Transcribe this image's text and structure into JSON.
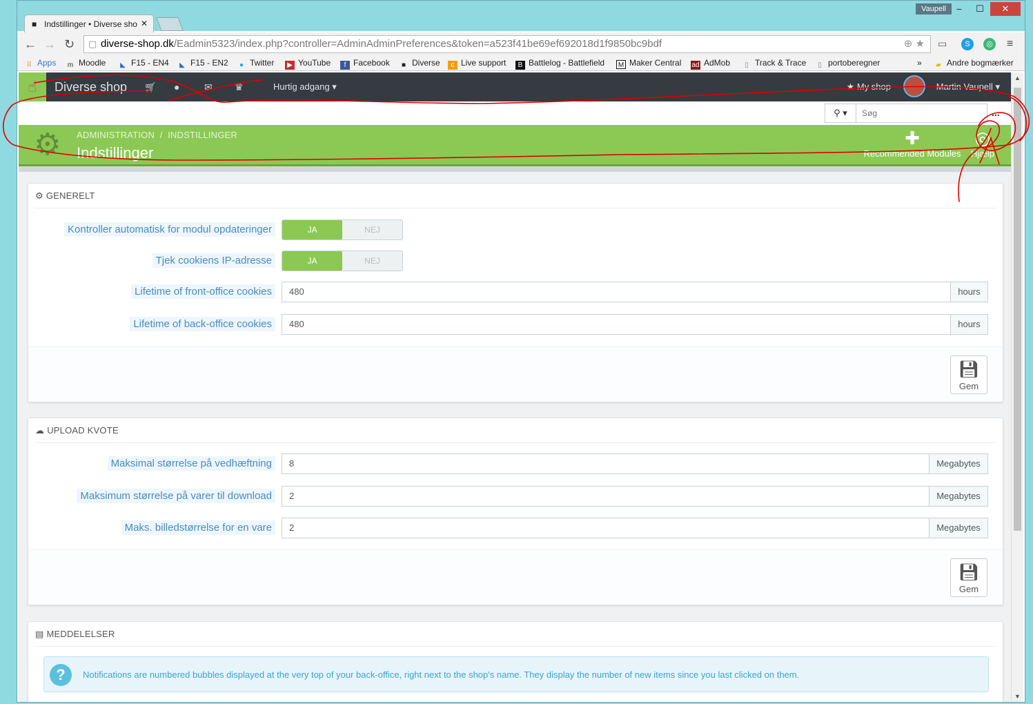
{
  "browser": {
    "profile": "Vaupell",
    "tab_title": "Indstillinger • Diverse sho",
    "url_host": "diverse-shop.dk",
    "url_path": "/Eadmin5323/index.php?controller=AdminAdminPreferences&token=a523f41be69ef692018d1f9850bc9bdf",
    "bookmarks": [
      "Apps",
      "Moodle",
      "F15 - EN4",
      "F15 - EN2",
      "Twitter",
      "YouTube",
      "Facebook",
      "Diverse",
      "Live support",
      "Battlelog - Battlefield",
      "Maker Central",
      "AdMob",
      "Track & Trace",
      "portoberegner"
    ],
    "bookmarks_more": "»",
    "other_bookmarks": "Andre bogmærker"
  },
  "topnav": {
    "shop_name": "Diverse shop",
    "quick_access": "Hurtig adgang",
    "my_shop": "My shop",
    "user": "Martin Vaupell"
  },
  "search": {
    "placeholder": "Søg",
    "more": "..."
  },
  "header": {
    "crumb_1": "ADMINISTRATION",
    "crumb_sep": "/",
    "crumb_2": "INDSTILLINGER",
    "title": "Indstillinger",
    "recommended": "Recommended Modules",
    "help": "Hjælp"
  },
  "general": {
    "title": "GENERELT",
    "rows": [
      {
        "label": "Kontroller automatisk for modul opdateringer",
        "yes": "JA",
        "no": "NEJ"
      },
      {
        "label": "Tjek cookiens IP-adresse",
        "yes": "JA",
        "no": "NEJ"
      },
      {
        "label": "Lifetime of front-office cookies",
        "value": "480",
        "unit": "hours"
      },
      {
        "label": "Lifetime of back-office cookies",
        "value": "480",
        "unit": "hours"
      }
    ],
    "save": "Gem"
  },
  "upload": {
    "title": "UPLOAD KVOTE",
    "rows": [
      {
        "label": "Maksimal størrelse på vedhæftning",
        "value": "8",
        "unit": "Megabytes"
      },
      {
        "label": "Maksimum størrelse på varer til download",
        "value": "2",
        "unit": "Megabytes"
      },
      {
        "label": "Maks. billedstørrelse for en vare",
        "value": "2",
        "unit": "Megabytes"
      }
    ],
    "save": "Gem"
  },
  "notifications": {
    "title": "MEDDELELSER",
    "info": "Notifications are numbered bubbles displayed at the very top of your back-office, right next to the shop's name. They display the number of new items since you last clicked on them."
  },
  "colors": {
    "accent": "#8bc954",
    "topbar": "#363a41",
    "label": "#4b8bbf",
    "annotation": "#e00000"
  }
}
